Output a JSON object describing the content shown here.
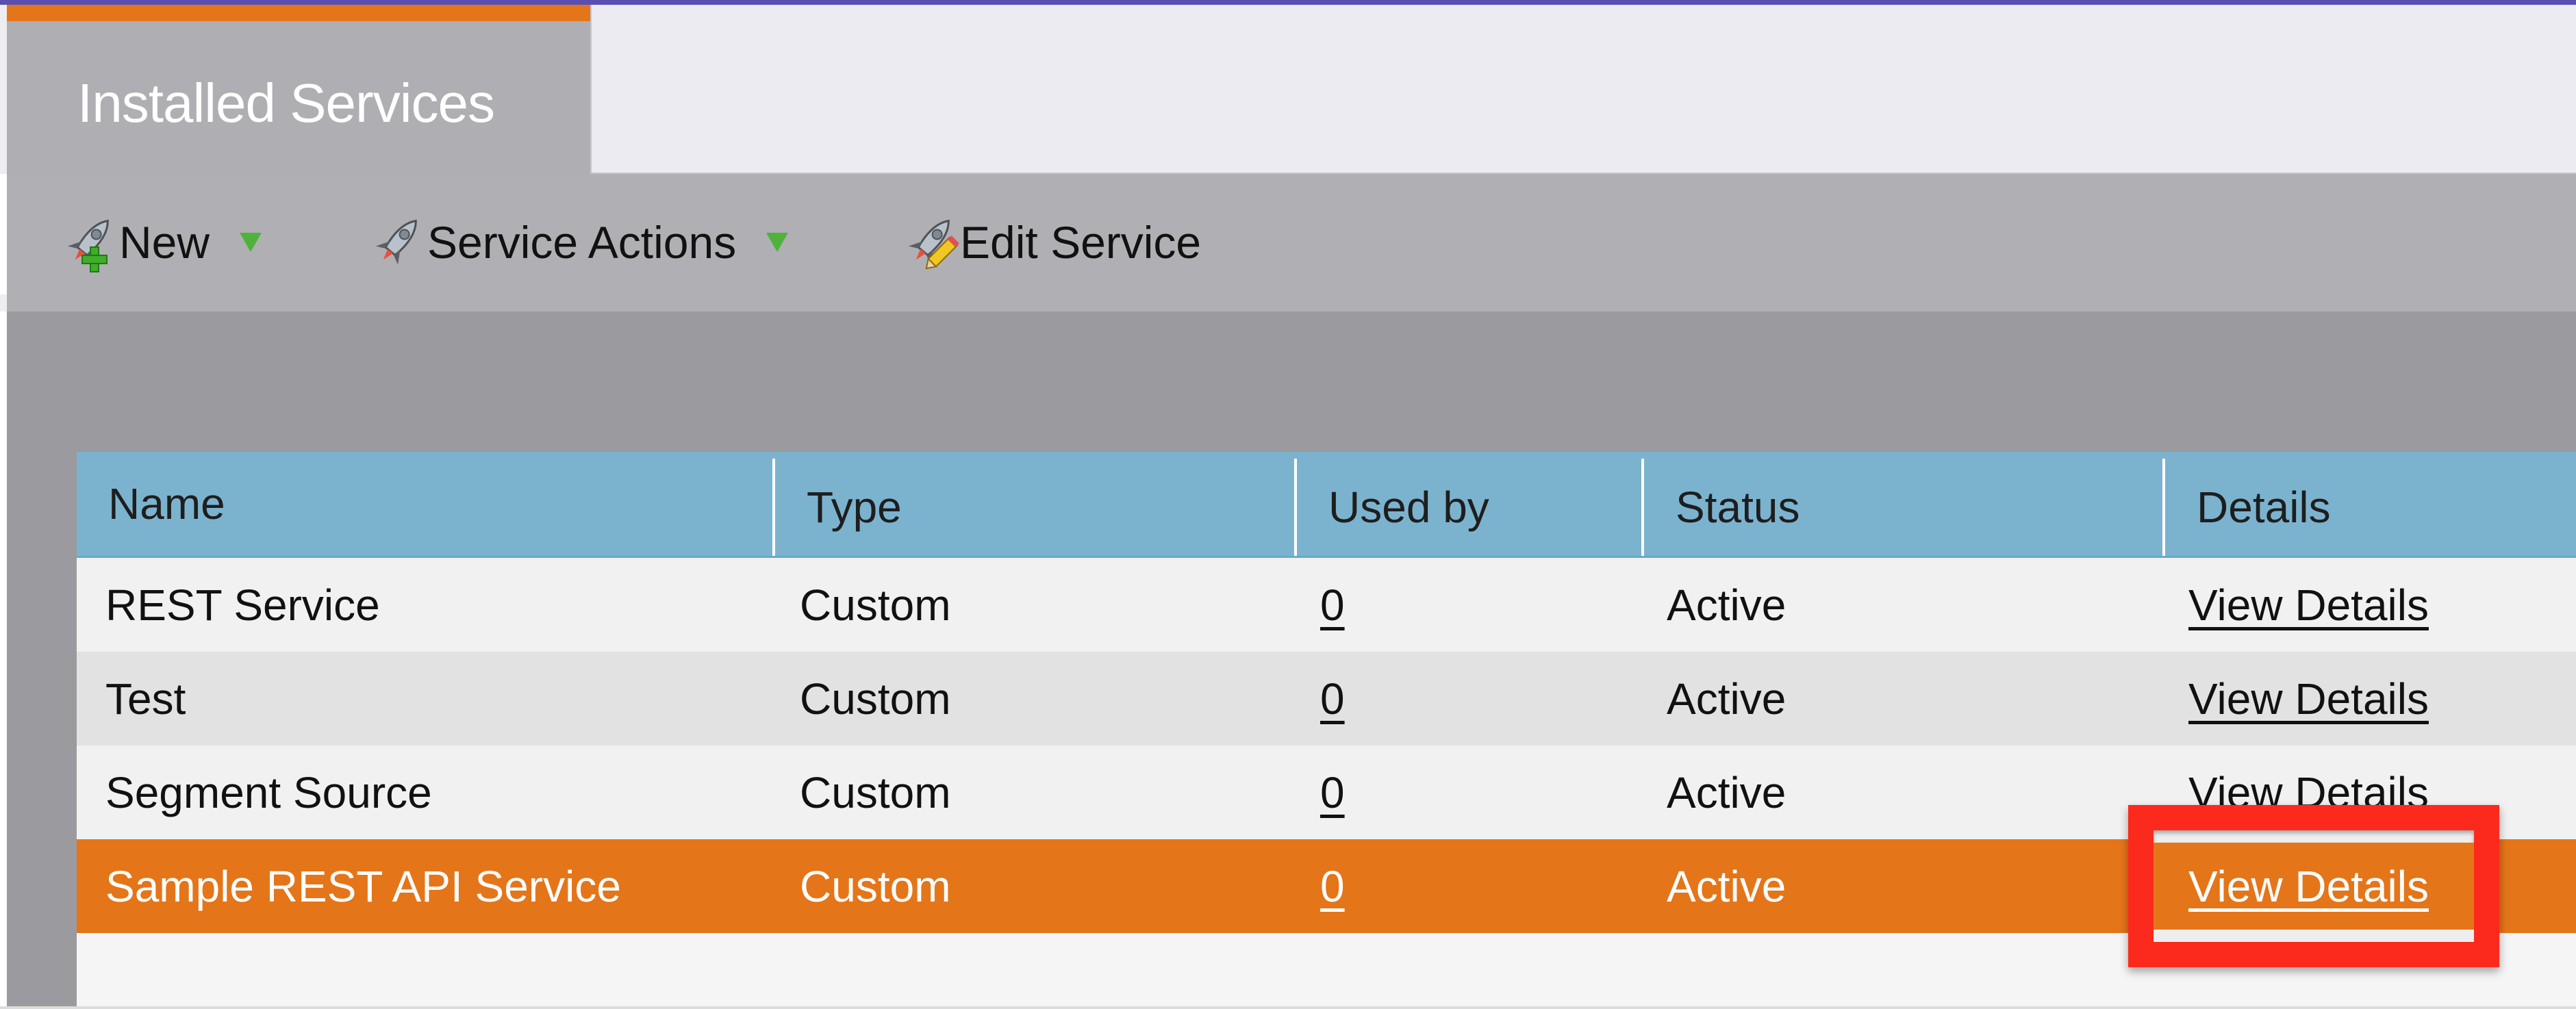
{
  "tab": {
    "title": "Installed Services",
    "accent_color": "#e57519"
  },
  "toolbar": {
    "items": [
      {
        "label": "New",
        "icon": "rocket-add-icon",
        "has_dropdown": true
      },
      {
        "label": "Service Actions",
        "icon": "rocket-icon",
        "has_dropdown": true
      },
      {
        "label": "Edit Service",
        "icon": "rocket-edit-icon",
        "has_dropdown": false
      }
    ]
  },
  "table": {
    "columns": [
      "Name",
      "Type",
      "Used by",
      "Status",
      "Details"
    ],
    "rows": [
      {
        "name": "REST Service",
        "type": "Custom",
        "used_by": "0",
        "status": "Active",
        "details": "View Details",
        "selected": false
      },
      {
        "name": "Test",
        "type": "Custom",
        "used_by": "0",
        "status": "Active",
        "details": "View Details",
        "selected": false
      },
      {
        "name": "Segment Source",
        "type": "Custom",
        "used_by": "0",
        "status": "Active",
        "details": "View Details",
        "selected": false
      },
      {
        "name": "Sample REST API Service",
        "type": "Custom",
        "used_by": "0",
        "status": "Active",
        "details": "View Details",
        "selected": true
      }
    ],
    "header_color": "#7bb3cf",
    "selected_row_color": "#e57519"
  },
  "annotation": {
    "highlight_target": "View Details",
    "highlight_color": "#fc2a1c"
  }
}
